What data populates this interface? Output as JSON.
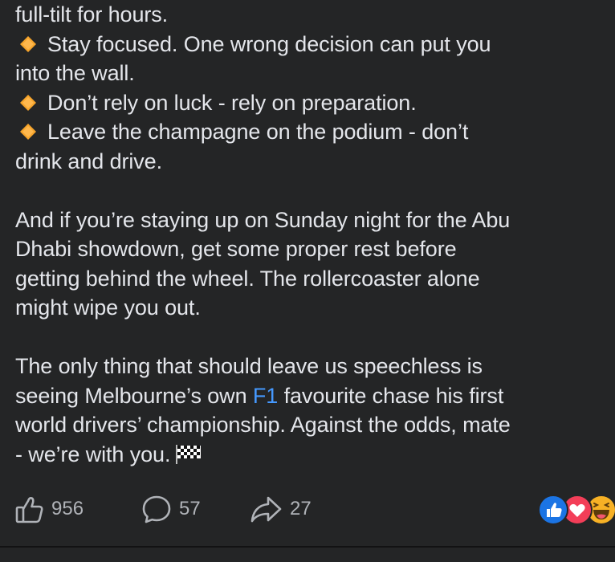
{
  "post": {
    "line_01": "full-tilt for hours.",
    "line_02": "Stay focused. One wrong decision can put you",
    "line_03": "into the wall.",
    "line_04": "Don’t rely on luck - rely on preparation.",
    "line_05": "Leave the champagne on the podium - don’t",
    "line_06": "drink and drive.",
    "line_07": "And if you’re staying up on Sunday night for the Abu",
    "line_08": "Dhabi showdown, get some proper rest before",
    "line_09": "getting behind the wheel. The rollercoaster alone",
    "line_10": "might wipe you out.",
    "line_11": "The only thing that should leave us speechless is",
    "line_12a": "seeing Melbourne’s own ",
    "line_12_link": "F1",
    "line_12b": " favourite chase his first",
    "line_13": "world drivers’ championship. Against the odds, mate",
    "line_14": "- we’re with you.",
    "bullet_icon": "orange-diamond-emoji",
    "end_icon": "chequered-flag-emoji",
    "link_color": "#4599ff"
  },
  "actions": {
    "like_count": "956",
    "comment_count": "57",
    "share_count": "27"
  },
  "reactions": {
    "items": [
      "like",
      "love",
      "haha"
    ],
    "colors": {
      "like": "#1b74e4",
      "love": "#f33e58",
      "haha": "#f7b125"
    }
  },
  "theme": {
    "background": "#242526",
    "text": "#e4e6eb",
    "muted": "#b0b3b8"
  }
}
